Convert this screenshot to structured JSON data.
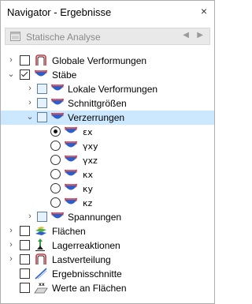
{
  "panel": {
    "title": "Navigator - Ergebnisse",
    "close_glyph": "×"
  },
  "dropdown": {
    "value": "Statische Analyse",
    "prev_glyph": "◀",
    "next_glyph": "▶"
  },
  "tree": {
    "globale_verformungen": "Globale Verformungen",
    "staebe": "Stäbe",
    "lokale_verformungen": "Lokale Verformungen",
    "schnittgroessen": "Schnittgrößen",
    "verzerrungen": "Verzerrungen",
    "strains": [
      "εx",
      "γxy",
      "γxz",
      "κx",
      "κy",
      "κz"
    ],
    "spannungen": "Spannungen",
    "flaechen": "Flächen",
    "lagerreaktionen": "Lagerreaktionen",
    "lastverteilung": "Lastverteilung",
    "ergebnisschnitte": "Ergebnisschnitte",
    "werte_an_flaechen": "Werte an Flächen"
  },
  "colors": {
    "selected_row": "#cce8ff",
    "member_icon_red": "#d6323b",
    "member_icon_blue": "#2e5fc8"
  }
}
